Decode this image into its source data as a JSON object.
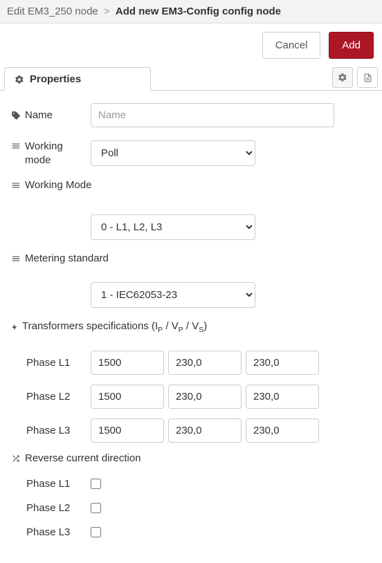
{
  "breadcrumb": {
    "prev": "Edit EM3_250 node",
    "sep": ">",
    "current": "Add new EM3-Config config node"
  },
  "actions": {
    "cancel": "Cancel",
    "add": "Add"
  },
  "tabs": {
    "properties": "Properties"
  },
  "form": {
    "name_label": "Name",
    "name_placeholder": "Name",
    "name_value": "",
    "working_mode_label": "Working mode",
    "working_mode_value": "Poll",
    "working_mode_section": "Working Mode",
    "phases_select": "0 - L1, L2, L3",
    "metering_section": "Metering standard",
    "metering_value": "1 - IEC62053-23",
    "transformers_prefix": "Transformers specifications (I",
    "transformers_mid1": " / V",
    "transformers_mid2": " / V",
    "transformers_suffix": ")",
    "sub_p": "P",
    "sub_s": "S",
    "phase_l1_label": "Phase L1",
    "phase_l2_label": "Phase L2",
    "phase_l3_label": "Phase L3",
    "l1_ip": "1500",
    "l1_vp": "230,0",
    "l1_vs": "230,0",
    "l2_ip": "1500",
    "l2_vp": "230,0",
    "l2_vs": "230,0",
    "l3_ip": "1500",
    "l3_vp": "230,0",
    "l3_vs": "230,0",
    "reverse_section": "Reverse current direction"
  }
}
